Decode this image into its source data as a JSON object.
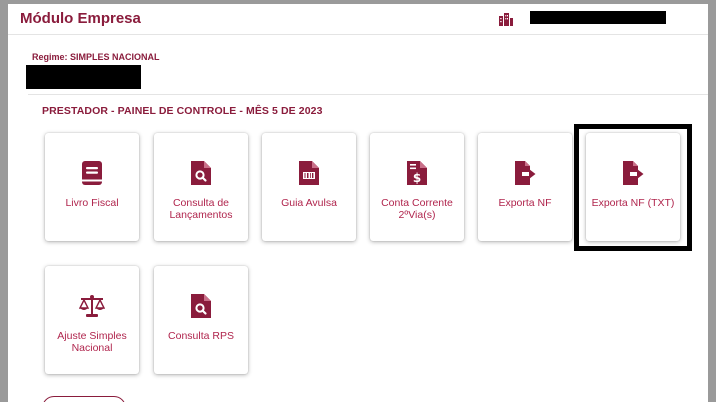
{
  "header": {
    "title": "Módulo Empresa",
    "user_icon": "building-icon"
  },
  "company": {
    "regime": "Regime: SIMPLES NACIONAL"
  },
  "panel": {
    "section_title": "PRESTADOR - PAINEL DE CONTROLE - MÊS 5 DE 2023",
    "tiles": [
      {
        "label": "Livro Fiscal",
        "icon": "book-icon"
      },
      {
        "label": "Consulta de Lançamentos",
        "icon": "file-search-icon"
      },
      {
        "label": "Guia Avulsa",
        "icon": "file-barcode-icon"
      },
      {
        "label": "Conta Corrente 2ºVia(s)",
        "icon": "file-invoice-dollar-icon"
      },
      {
        "label": "Exporta NF",
        "icon": "file-export-icon"
      },
      {
        "label": "Exporta NF (TXT)",
        "icon": "file-export-icon"
      },
      {
        "label": "Ajuste Simples Nacional",
        "icon": "balance-scale-icon"
      },
      {
        "label": "Consulta RPS",
        "icon": "file-search-icon"
      }
    ]
  },
  "colors": {
    "brand": "#8a1c3c",
    "label": "#b0254d"
  }
}
